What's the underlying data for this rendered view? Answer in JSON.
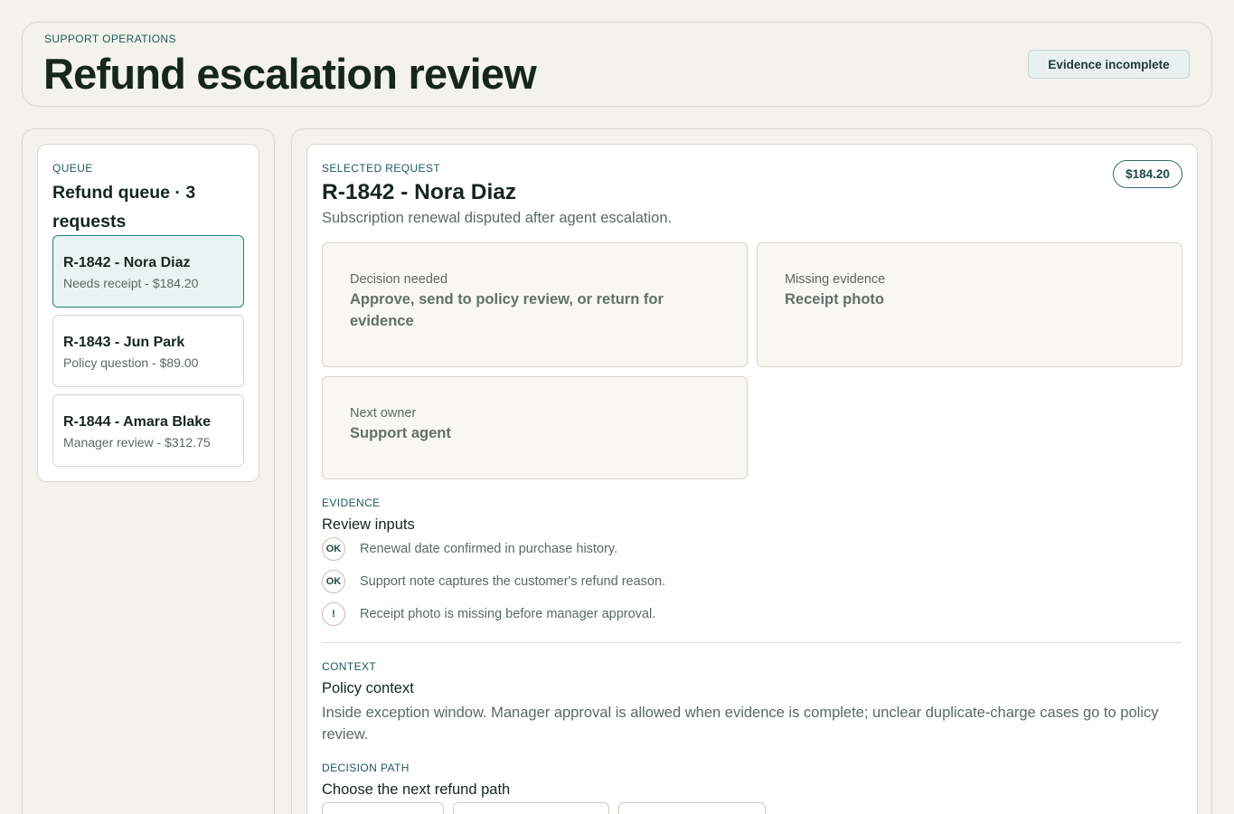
{
  "header": {
    "eyebrow": "SUPPORT OPERATIONS",
    "title": "Refund escalation review",
    "status_badge": "Evidence incomplete"
  },
  "queue": {
    "eyebrow": "QUEUE",
    "title": "Refund queue · 3 requests",
    "items": [
      {
        "title": "R-1842 - Nora Diaz",
        "subtitle": "Needs receipt - $184.20",
        "selected": true
      },
      {
        "title": "R-1843 - Jun Park",
        "subtitle": "Policy question - $89.00",
        "selected": false
      },
      {
        "title": "R-1844 - Amara Blake",
        "subtitle": "Manager review - $312.75",
        "selected": false
      }
    ]
  },
  "detail": {
    "eyebrow": "SELECTED REQUEST",
    "title": "R-1842 - Nora Diaz",
    "subtitle": "Subscription renewal disputed after agent escalation.",
    "amount": "$184.20",
    "boxes": [
      {
        "label": "Decision needed",
        "value": "Approve, send to policy review, or return for evidence"
      },
      {
        "label": "Missing evidence",
        "value": "Receipt photo"
      },
      {
        "label": "Next owner",
        "value": "Support agent"
      }
    ]
  },
  "evidence": {
    "eyebrow": "EVIDENCE",
    "title": "Review inputs",
    "items": [
      {
        "badge": "OK",
        "text": "Renewal date confirmed in purchase history."
      },
      {
        "badge": "OK",
        "text": "Support note captures the customer's refund reason."
      },
      {
        "badge": "!",
        "text": "Receipt photo is missing before manager approval."
      }
    ]
  },
  "context": {
    "eyebrow": "CONTEXT",
    "title": "Policy context",
    "text": "Inside exception window. Manager approval is allowed when evidence is complete; unclear duplicate-charge cases go to policy review."
  },
  "decision_path": {
    "eyebrow": "DECISION PATH",
    "title": "Choose the next refund path"
  },
  "colors": {
    "background": "#f3f2ee",
    "accent": "#2f7d74",
    "selected_item_bg": "#e9f4f2",
    "text_primary": "#17251f",
    "text_muted": "#5d6864"
  }
}
